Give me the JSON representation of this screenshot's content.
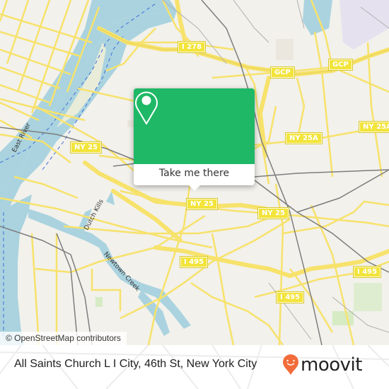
{
  "map": {
    "shields": [
      {
        "id": "i278",
        "label": "I 278"
      },
      {
        "id": "gcp-1",
        "label": "GCP"
      },
      {
        "id": "gcp-2",
        "label": "GCP"
      },
      {
        "id": "ny25a-1",
        "label": "NY 25A"
      },
      {
        "id": "ny25a-2",
        "label": "NY 25A"
      },
      {
        "id": "ny25-1",
        "label": "NY 25"
      },
      {
        "id": "ny25-2",
        "label": "NY 25"
      },
      {
        "id": "ny25-3",
        "label": "NY 25"
      },
      {
        "id": "i495-1",
        "label": "I 495"
      },
      {
        "id": "i495-2",
        "label": "I 495"
      },
      {
        "id": "i495-3",
        "label": "I 495"
      }
    ],
    "water_labels": {
      "east_river": "East River",
      "dutch_kills": "Dutch Kills",
      "newtown_creek": "Newtown Creek"
    },
    "attribution": "© OpenStreetMap contributors"
  },
  "popup": {
    "icon": "map-pin-icon",
    "button_label": "Take me there",
    "accent_color": "#1fb866"
  },
  "footer": {
    "location_title": "All Saints Church L I City, 46th St, New York City",
    "brand": {
      "name": "moovit",
      "logo_icon": "moovit-pin-smiley-icon",
      "logo_color": "#f26b3a"
    }
  }
}
